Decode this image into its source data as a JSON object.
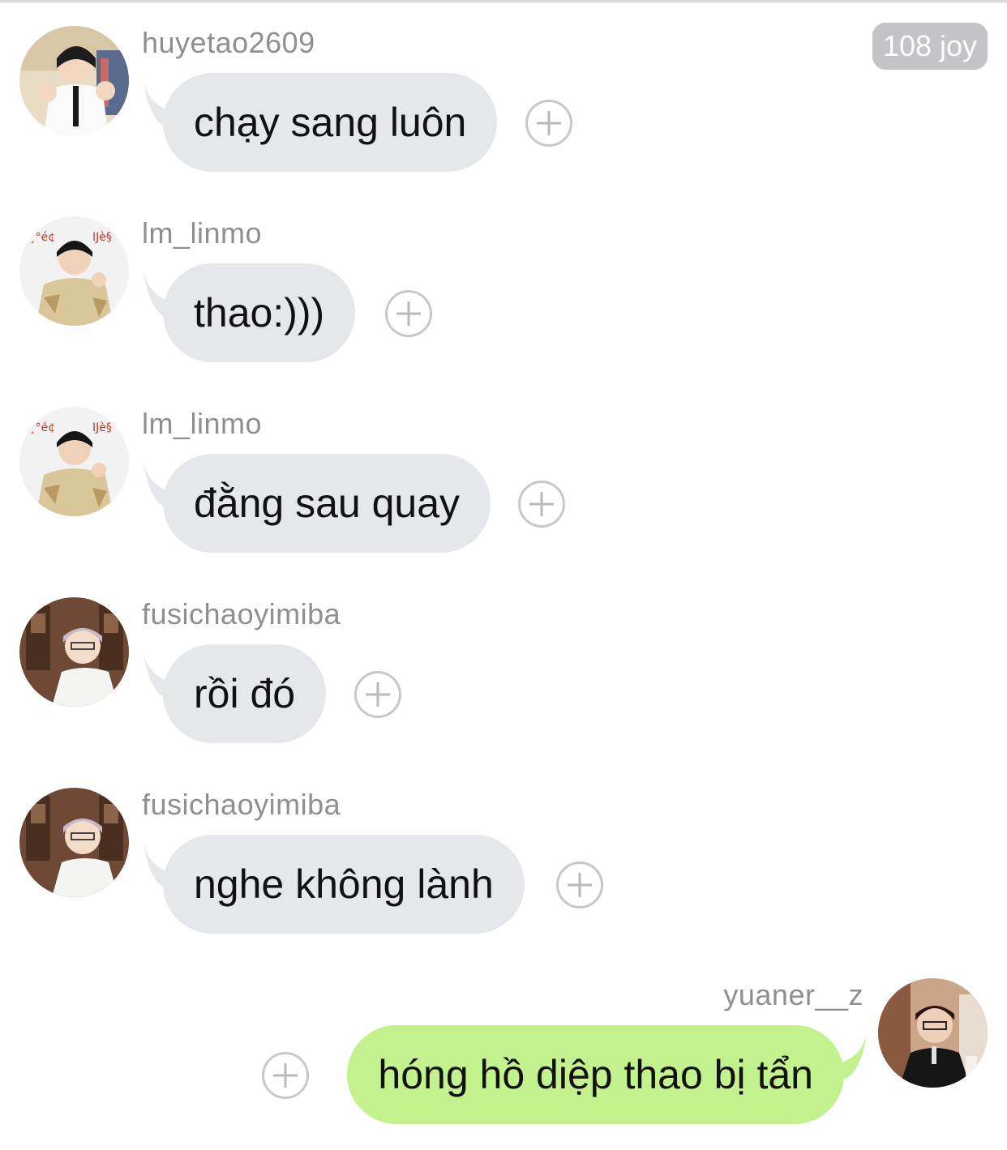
{
  "joy_badge": "108 joy",
  "colors": {
    "incoming_bubble": "#e5e7ea",
    "outgoing_bubble": "#c3f18d",
    "username": "#8e8e93",
    "badge": "#c4c4c6"
  },
  "messages": [
    {
      "username": "huyetao2609",
      "text": "chạy sang luôn",
      "direction": "incoming",
      "avatar_icon": "avatar-huyetao2609-icon"
    },
    {
      "username": "lm_linmo",
      "text": "thao:)))",
      "direction": "incoming",
      "avatar_icon": "avatar-lm-linmo-icon"
    },
    {
      "username": "lm_linmo",
      "text": "đằng sau quay",
      "direction": "incoming",
      "avatar_icon": "avatar-lm-linmo-icon"
    },
    {
      "username": "fusichaoyimiba",
      "text": "rồi đó",
      "direction": "incoming",
      "avatar_icon": "avatar-fusichaoyimiba-icon"
    },
    {
      "username": "fusichaoyimiba",
      "text": "nghe không lành",
      "direction": "incoming",
      "avatar_icon": "avatar-fusichaoyimiba-icon"
    },
    {
      "username": "yuaner__z",
      "text": "hóng hồ diệp thao bị tẩn",
      "direction": "outgoing",
      "avatar_icon": "avatar-yuaner-z-icon"
    }
  ]
}
